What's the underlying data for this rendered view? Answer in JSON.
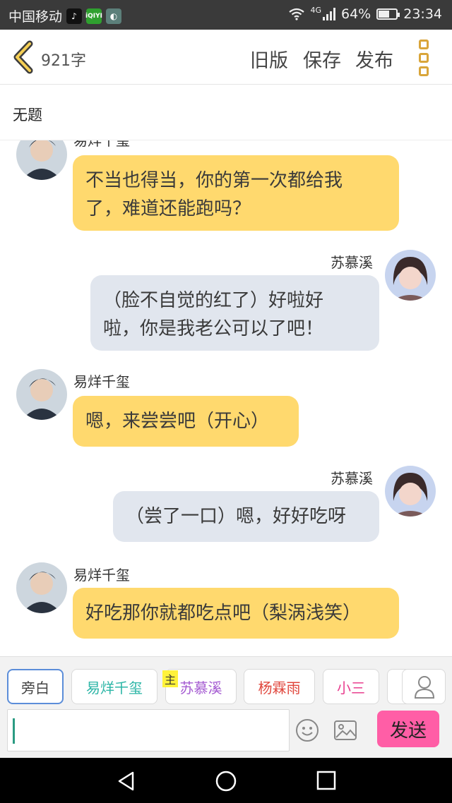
{
  "status_bar": {
    "carrier": "中国移动",
    "network": "4G",
    "battery": "64%",
    "battery_level": 0.64,
    "time": "23:34"
  },
  "header": {
    "word_count": "921字",
    "old_version": "旧版",
    "save": "保存",
    "publish": "发布"
  },
  "title": "无题",
  "messages": [
    {
      "speaker": "易烊千玺",
      "side": "left",
      "text_lines": [
        "不当也得当，你的第一次都给我",
        "了，难道还能跑吗？"
      ]
    },
    {
      "speaker": "苏慕溪",
      "side": "right",
      "text_lines": [
        "（脸不自觉的红了）好啦好",
        "啦，你是我老公可以了吧！"
      ]
    },
    {
      "speaker": "易烊千玺",
      "side": "left",
      "text_lines": [
        "嗯，来尝尝吧（开心）"
      ]
    },
    {
      "speaker": "苏慕溪",
      "side": "right",
      "text_lines": [
        "（尝了一口）嗯，好好吃呀"
      ]
    },
    {
      "speaker": "易烊千玺",
      "side": "left",
      "text_lines": [
        "好吃那你就都吃点吧（梨涡浅笑）"
      ]
    }
  ],
  "roles": [
    {
      "label": "旁白",
      "color": "#444444",
      "selected": true
    },
    {
      "label": "易烊千玺",
      "color": "#2bb5a6"
    },
    {
      "label": "苏慕溪",
      "color": "#a45ad1",
      "main_tag": "主"
    },
    {
      "label": "杨霖雨",
      "color": "#e0463c"
    },
    {
      "label": "小三",
      "color": "#e83f8f"
    }
  ],
  "input": {
    "value": ""
  },
  "send_label": "发送",
  "colors": {
    "left_bubble": "#ffd96e",
    "right_bubble": "#e1e6ee",
    "send_button": "#ff5ea6",
    "accent": "#d9a53a"
  },
  "icons": [
    "back-chevron-icon",
    "more-menu-icon",
    "person-icon",
    "emoji-icon",
    "image-icon",
    "nav-back-icon",
    "nav-home-icon",
    "nav-recents-icon"
  ]
}
